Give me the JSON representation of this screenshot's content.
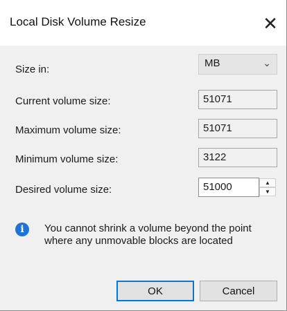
{
  "window": {
    "title": "Local Disk Volume Resize",
    "close_symbol": "✕"
  },
  "form": {
    "size_in_label": "Size in:",
    "size_in_value": "MB",
    "current_label": "Current volume size:",
    "current_value": "51071",
    "maximum_label": "Maximum volume size:",
    "maximum_value": "51071",
    "minimum_label": "Minimum volume size:",
    "minimum_value": "3122",
    "desired_label": "Desired volume size:",
    "desired_value": "51000"
  },
  "info": {
    "text": "You cannot shrink a volume beyond the point where any unmovable blocks are located"
  },
  "buttons": {
    "ok": "OK",
    "cancel": "Cancel"
  },
  "colors": {
    "accent": "#0078d7",
    "info_icon": "#1e73d6",
    "dialog_bg": "#f0f0f0"
  }
}
